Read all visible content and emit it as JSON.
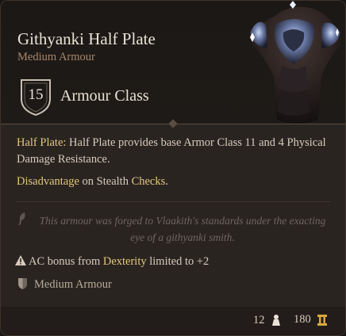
{
  "item": {
    "name": "Githyanki Half Plate",
    "type": "Medium Armour",
    "armour_class_value": "15",
    "armour_class_label": "Armour Class",
    "description_term": "Half Plate:",
    "description_text": " Half Plate provides base Armor Class 11 and 4 Physical Damage Resistance.",
    "disadvantage": {
      "word1": "Disadvantage",
      "word2": " on ",
      "word3": "Stealth",
      "word4": " ",
      "word5": "Checks",
      "word6": "."
    },
    "lore": "This armour was forged to Vlaakith's standards under the exacting eye of a githyanki smith.",
    "warning": {
      "pre": "AC bonus from ",
      "kw": "Dexterity",
      "post": " limited to +2"
    },
    "proficiency": "Medium Armour",
    "weight": "12",
    "price": "180"
  },
  "icons": {
    "shield": "armour-class-shield-icon",
    "lore": "quill-icon",
    "warning": "warning-triangle-icon",
    "proficiency": "medium-armour-shield-icon",
    "weight": "weight-icon",
    "currency": "gold-coin-icon"
  },
  "colors": {
    "keyword": "#e3c77f",
    "subtitle": "#a8876a",
    "lore": "#6e655e"
  }
}
